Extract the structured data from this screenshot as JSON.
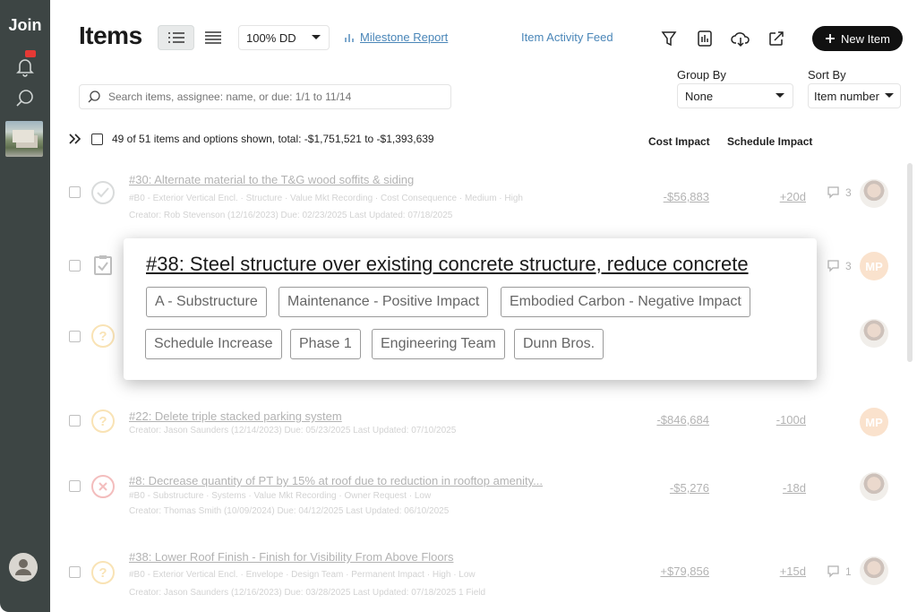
{
  "app": {
    "logo": "Join"
  },
  "header": {
    "title": "Items",
    "zoom": "100% DD",
    "milestone_link": "Milestone Report",
    "activity_link": "Item Activity Feed",
    "new_item_label": "New Item"
  },
  "controls": {
    "group_by_label": "Group By",
    "group_by_value": "None",
    "sort_by_label": "Sort By",
    "sort_by_value": "Item number",
    "search_placeholder": "Search items, assignee: name, or due: 1/1 to 11/14"
  },
  "summary": {
    "text": "49 of 51 items and options shown, total: -$1,751,521 to -$1,393,639",
    "cost_header": "Cost Impact",
    "schedule_header": "Schedule Impact"
  },
  "rows": [
    {
      "title": "#30: Alternate material to the T&G wood soffits & siding",
      "meta1": "#B0 - Exterior Vertical Encl.  ·  Structure  ·  Value Mkt Recording  ·  Cost Consequence  ·  Medium  ·  High",
      "meta2": "Creator: Rob Stevenson (12/16/2023)  Due: 02/23/2025  Last Updated: 07/18/2025",
      "cost": "-$56,883",
      "schedule": "+20d",
      "comments": "3",
      "status": "accepted"
    },
    {
      "title": "#38: Steel structure over existing concrete structure, reduce concrete",
      "cost": "",
      "schedule": "",
      "comments": "3",
      "avatar": "MP",
      "status": "pending"
    },
    {
      "title": "",
      "cost": "",
      "schedule": "",
      "status": "question"
    },
    {
      "title": "#22: Delete triple stacked parking system",
      "meta1": "Creator: Jason Saunders (12/14/2023)  Due: 05/23/2025  Last Updated: 07/10/2025",
      "cost": "-$846,684",
      "schedule": "-100d",
      "avatar": "MP",
      "status": "question"
    },
    {
      "title": "#8: Decrease quantity of PT by 15% at roof due to reduction in rooftop amenity...",
      "meta1": "#B0 - Substructure  ·  Systems  ·  Value Mkt Recording  ·  Owner Request  ·  Low",
      "meta2": "Creator: Thomas Smith (10/09/2024)  Due: 04/12/2025  Last Updated: 06/10/2025",
      "cost": "-$5,276",
      "schedule": "-18d",
      "status": "rejected"
    },
    {
      "title": "#38: Lower Roof Finish - Finish for Visibility From Above Floors",
      "meta1": "#B0 - Exterior Vertical Encl.  ·  Envelope  ·  Design Team  ·  Permanent Impact  ·  High  ·  Low",
      "meta2": "Creator: Jason Saunders (12/16/2023)  Due: 03/28/2025  Last Updated: 07/18/2025  1 Field",
      "cost": "+$79,856",
      "schedule": "+15d",
      "comments": "1",
      "status": "question"
    }
  ],
  "popover": {
    "title": "#38: Steel structure over existing concrete structure, reduce concrete",
    "tags": [
      "A - Substructure",
      "Maintenance - Positive Impact",
      "Embodied Carbon - Negative Impact",
      "Schedule Increase",
      "Phase 1",
      "Engineering Team",
      "Dunn Bros."
    ]
  },
  "colors": {
    "sidebar": "#3d4544",
    "link": "#4a86b8",
    "status_accepted": "#9aa0a0",
    "status_question": "#f0b43c",
    "status_rejected": "#e05050",
    "avatar_mp": "#f2b27a",
    "badge": "#e53935"
  }
}
